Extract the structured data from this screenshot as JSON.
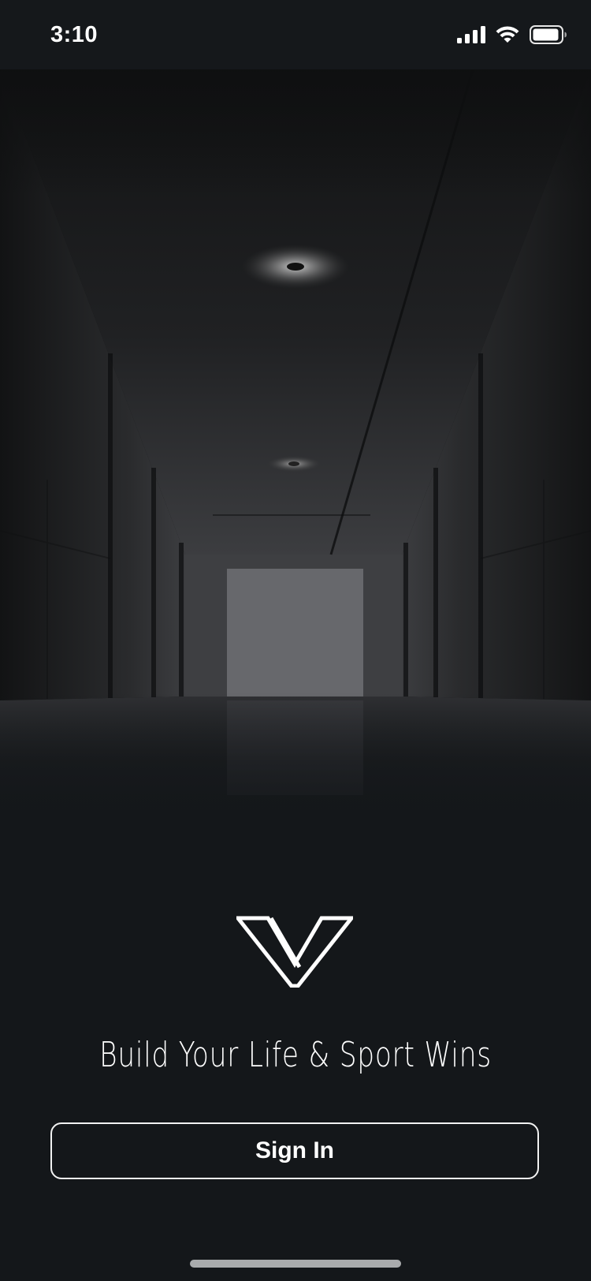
{
  "status_bar": {
    "time": "3:10",
    "icons": [
      "cellular-signal-icon",
      "wifi-icon",
      "battery-icon"
    ]
  },
  "hero": {
    "image": "dark-concrete-corridor-photo"
  },
  "brand": {
    "logo": "v-logo-icon",
    "tagline": "Build Your Life & Sport Wins"
  },
  "actions": {
    "signin_label": "Sign In"
  },
  "colors": {
    "background": "#14171a",
    "text": "#ffffff",
    "button_border": "#f2f2f2",
    "home_indicator": "#a9abad"
  }
}
